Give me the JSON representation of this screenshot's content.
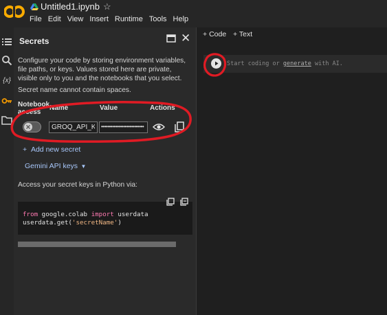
{
  "header": {
    "notebook_title": "Untitled1.ipynb",
    "logo_text": "CO",
    "menu": [
      "File",
      "Edit",
      "View",
      "Insert",
      "Runtime",
      "Tools",
      "Help"
    ]
  },
  "rail": {
    "icons": [
      "table-of-contents-icon",
      "search-icon",
      "variables-icon",
      "key-icon",
      "folder-icon"
    ],
    "variables_glyph": "{x}"
  },
  "secrets_panel": {
    "title": "Secrets",
    "description": "Configure your code by storing environment variables, file paths, or keys. Values stored here are private, visible only to you and the notebooks that you select.",
    "name_note": "Secret name cannot contain spaces.",
    "columns": {
      "notebook_access": "Notebook access",
      "name": "Name",
      "value": "Value",
      "actions": "Actions"
    },
    "secret_row": {
      "name": "GROQ_API_KE",
      "value_masked": "•••••••••••••••••••••••••••",
      "access_enabled": false
    },
    "add_new_secret": "Add new secret",
    "gemini_api_keys": "Gemini API keys",
    "access_note": "Access your secret keys in Python via:",
    "code": {
      "line1_kw1": "from",
      "line1_mod": " google.colab ",
      "line1_kw2": "import",
      "line1_name": " userdata",
      "line2_pre": "userdata.get(",
      "line2_str": "'secretName'",
      "line2_post": ")"
    }
  },
  "notebook": {
    "add_code": "Code",
    "add_text": "Text",
    "cell_placeholder_pre": "Start coding or ",
    "cell_placeholder_link": "generate",
    "cell_placeholder_post": " with AI."
  },
  "colors": {
    "accent_blue": "#a8c7fa",
    "annotation_red": "#e01b24",
    "logo_orange": "#f9ab00"
  }
}
